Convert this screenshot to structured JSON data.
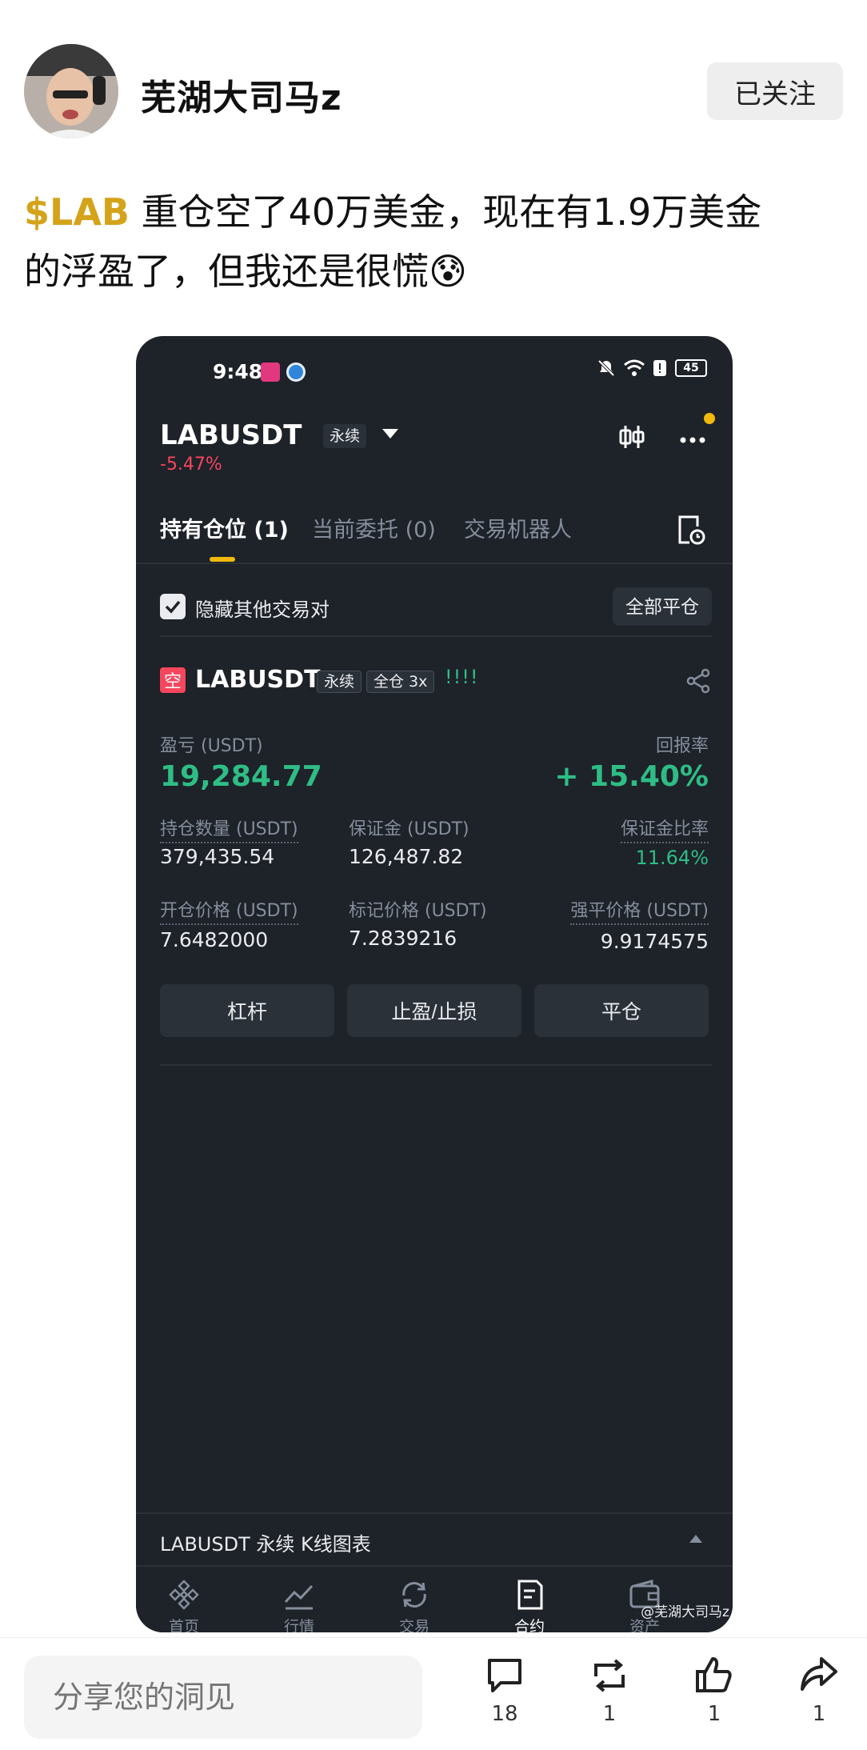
{
  "post": {
    "author": "芜湖大司马z",
    "follow_label": "已关注",
    "ticker": "$LAB",
    "text_line1": " 重仓空了40万美金，现在有1.9万美金",
    "text_line2": "的浮盈了，但我还是很慌😰"
  },
  "screenshot": {
    "status": {
      "time": "9:48",
      "battery": "45"
    },
    "pair": {
      "name": "LABUSDT",
      "badge": "永续",
      "change": "-5.47%"
    },
    "tabs": [
      {
        "label": "持有仓位 (1)"
      },
      {
        "label": "当前委托 (0)"
      },
      {
        "label": "交易机器人"
      }
    ],
    "hide_other": "隐藏其他交易对",
    "close_all": "全部平仓",
    "position": {
      "side": "空",
      "symbol": "LABUSDT",
      "badge_perp": "永续",
      "badge_margin": "全仓 3x",
      "bars": "!!!!",
      "pnl_label": "盈亏 (USDT)",
      "pnl_value": "19,284.77",
      "roe_label": "回报率",
      "roe_value": "+ 15.40%",
      "size_label": "持仓数量 (USDT)",
      "size_value": "379,435.54",
      "margin_label": "保证金 (USDT)",
      "margin_value": "126,487.82",
      "margin_ratio_label": "保证金比率",
      "margin_ratio_value": "11.64%",
      "entry_label": "开仓价格 (USDT)",
      "entry_value": "7.6482000",
      "mark_label": "标记价格 (USDT)",
      "mark_value": "7.2839216",
      "liq_label": "强平价格 (USDT)",
      "liq_value": "9.9174575"
    },
    "buttons": {
      "leverage": "杠杆",
      "tpsl": "止盈/止损",
      "close": "平仓"
    },
    "kline": "LABUSDT 永续 K线图表",
    "nav": [
      {
        "label": "首页",
        "icon": "binance-logo-icon"
      },
      {
        "label": "行情",
        "icon": "trend-chart-icon"
      },
      {
        "label": "交易",
        "icon": "exchange-icon"
      },
      {
        "label": "合约",
        "icon": "contract-icon"
      },
      {
        "label": "资产",
        "icon": "wallet-icon"
      }
    ],
    "watermark": "@芜湖大司马z"
  },
  "bottom_bar": {
    "placeholder": "分享您的洞见",
    "comments": "18",
    "reposts": "1",
    "likes": "1",
    "shares": "1"
  },
  "colors": {
    "ticker": "#d4a31a",
    "profit": "#2ebd85",
    "loss": "#f6465d",
    "accent": "#f0b90b",
    "phone_bg": "#1e2229"
  }
}
